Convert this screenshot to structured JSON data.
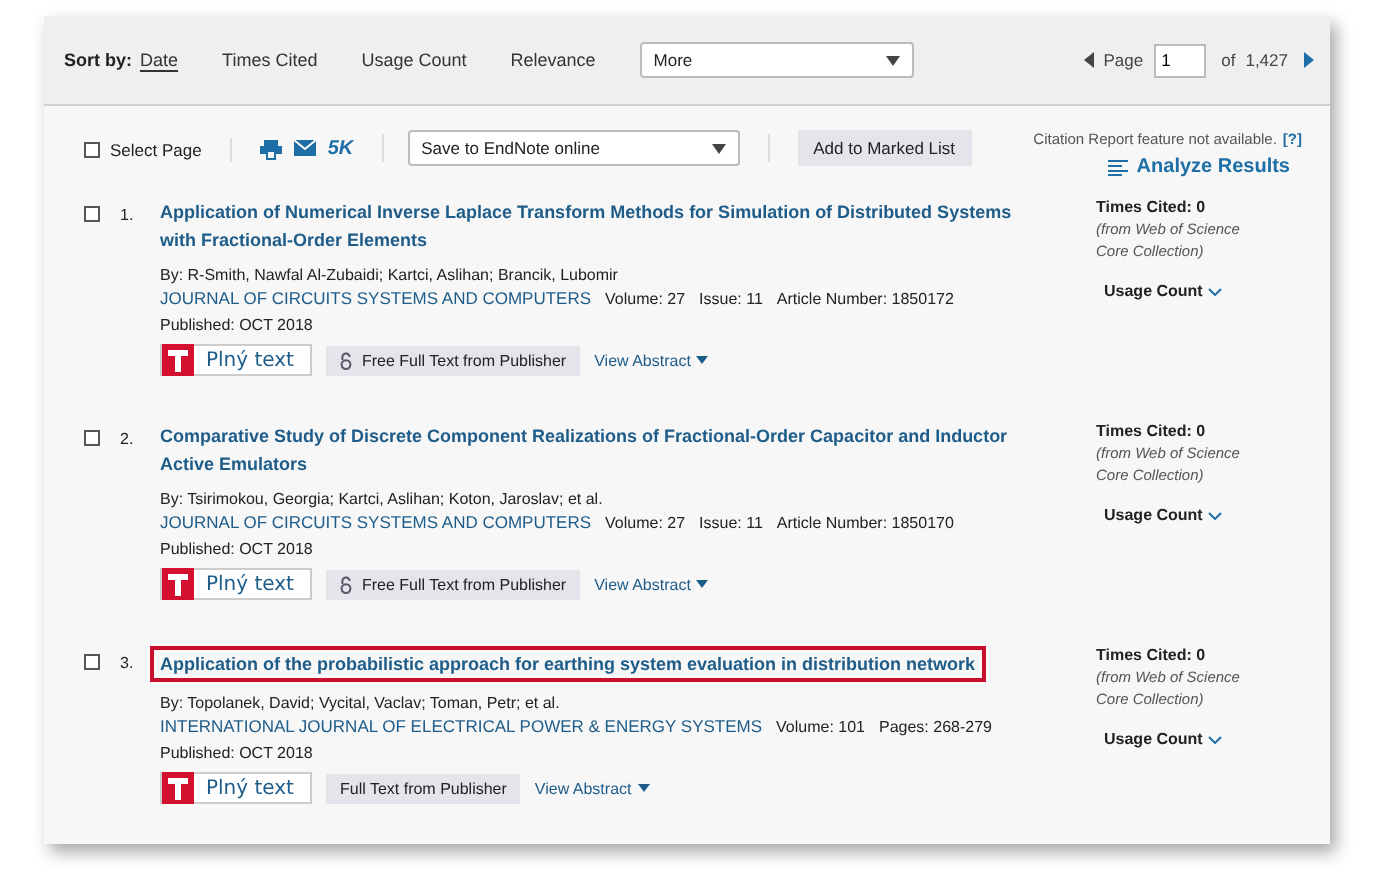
{
  "sort_bar": {
    "label": "Sort by:",
    "options": [
      {
        "label": "Date",
        "selected": true
      },
      {
        "label": "Times Cited",
        "selected": false
      },
      {
        "label": "Usage Count",
        "selected": false
      },
      {
        "label": "Relevance",
        "selected": false
      }
    ],
    "dropdown": {
      "value": "More"
    },
    "pager": {
      "label": "Page",
      "value": "1",
      "of": "of",
      "total": "1,427"
    }
  },
  "toolbar": {
    "select_page": {
      "label": "Select Page",
      "checked": false
    },
    "count": "5K",
    "save_dropdown": {
      "value": "Save to EndNote online"
    },
    "add_button": "Add to Marked List",
    "citation_note": "Citation Report feature not available.",
    "help_link": "[?]",
    "analyze": "Analyze Results"
  },
  "records": [
    {
      "number": "1.",
      "checked": false,
      "highlighted": false,
      "title": "Application of Numerical Inverse Laplace Transform Methods for Simulation of Distributed Systems with Fractional-Order Elements",
      "authors": "By: R-Smith, Nawfal Al-Zubaidi; Kartci, Aslihan; Brancik, Lubomir",
      "journal": "JOURNAL OF CIRCUITS SYSTEMS AND COMPUTERS",
      "details": [
        "Volume: 27",
        "Issue: 11",
        "Article Number: 1850172",
        "Published: OCT 2018"
      ],
      "full_text": "Plný text",
      "publisher": {
        "label": "Free Full Text from Publisher",
        "open_access": true
      },
      "view_abstract": "View Abstract",
      "times_cited": "Times Cited: 0",
      "source": "(from Web of Science Core Collection)",
      "usage": "Usage Count"
    },
    {
      "number": "2.",
      "checked": false,
      "highlighted": false,
      "title": "Comparative Study of Discrete Component Realizations of Fractional-Order Capacitor and Inductor Active Emulators",
      "authors": "By: Tsirimokou, Georgia; Kartci, Aslihan; Koton, Jaroslav; et al.",
      "journal": "JOURNAL OF CIRCUITS SYSTEMS AND COMPUTERS",
      "details": [
        "Volume: 27",
        "Issue: 11",
        "Article Number: 1850170",
        "Published: OCT 2018"
      ],
      "full_text": "Plný text",
      "publisher": {
        "label": "Free Full Text from Publisher",
        "open_access": true
      },
      "view_abstract": "View Abstract",
      "times_cited": "Times Cited: 0",
      "source": "(from Web of Science Core Collection)",
      "usage": "Usage Count"
    },
    {
      "number": "3.",
      "checked": false,
      "highlighted": true,
      "title": "Application of the probabilistic approach for earthing system evaluation in distribution network",
      "authors": "By: Topolanek, David; Vycital, Vaclav; Toman, Petr; et al.",
      "journal": "INTERNATIONAL JOURNAL OF ELECTRICAL POWER & ENERGY SYSTEMS",
      "details": [
        "Volume: 101",
        "Pages: 268-279",
        "Published: OCT 2018"
      ],
      "full_text": "Plný text",
      "publisher": {
        "label": "Full Text from Publisher",
        "open_access": false
      },
      "view_abstract": "View Abstract",
      "times_cited": "Times Cited: 0",
      "source": "(from Web of Science Core Collection)",
      "usage": "Usage Count"
    }
  ]
}
